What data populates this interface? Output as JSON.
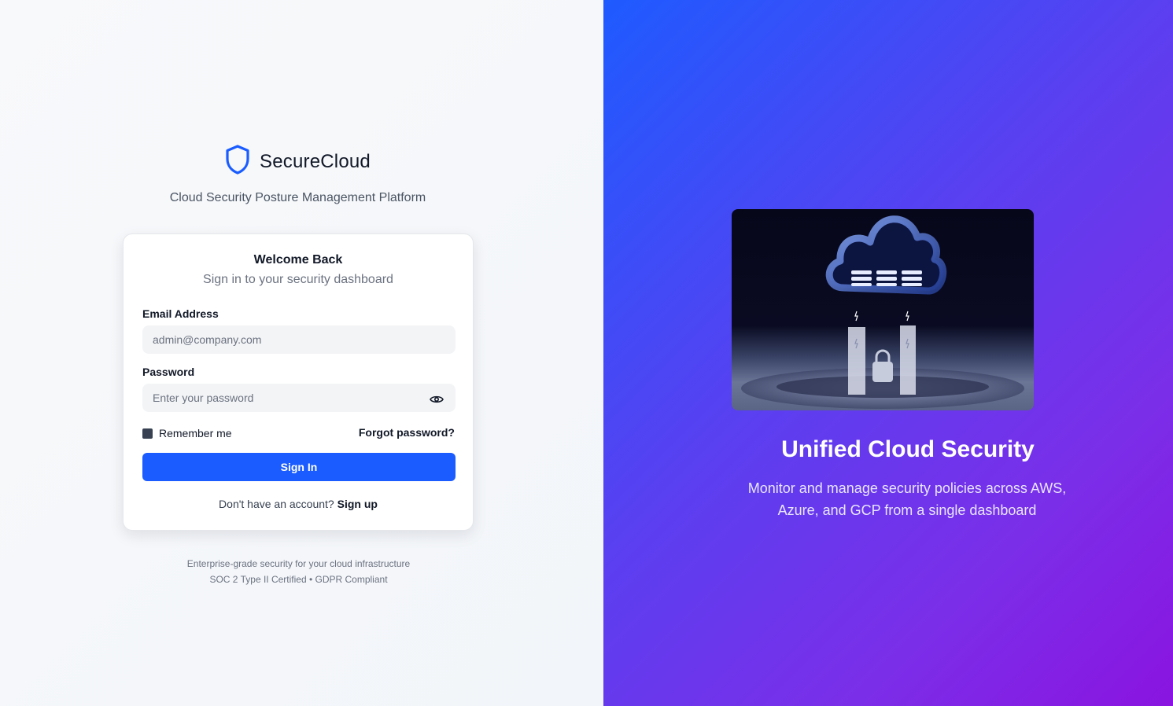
{
  "brand": {
    "name": "SecureCloud",
    "tagline": "Cloud Security Posture Management Platform"
  },
  "login": {
    "title": "Welcome Back",
    "subtitle": "Sign in to your security dashboard",
    "email_label": "Email Address",
    "email_placeholder": "admin@company.com",
    "email_value": "",
    "password_label": "Password",
    "password_placeholder": "Enter your password",
    "password_value": "",
    "remember_label": "Remember me",
    "remember_checked": true,
    "forgot_label": "Forgot password?",
    "signin_label": "Sign In",
    "signup_prompt": "Don't have an account?",
    "signup_label": "Sign up"
  },
  "footer": {
    "line1": "Enterprise-grade security for your cloud infrastructure",
    "line2": "SOC 2 Type II Certified • GDPR Compliant"
  },
  "hero": {
    "title": "Unified Cloud Security",
    "description": "Monitor and manage security policies across AWS, Azure, and GCP from a single dashboard"
  },
  "colors": {
    "accent": "#1a5cff",
    "gradient_start": "#1e5bff",
    "gradient_end": "#8a14e0"
  },
  "icons": {
    "logo": "shield-icon",
    "password_toggle": "eye-icon"
  }
}
